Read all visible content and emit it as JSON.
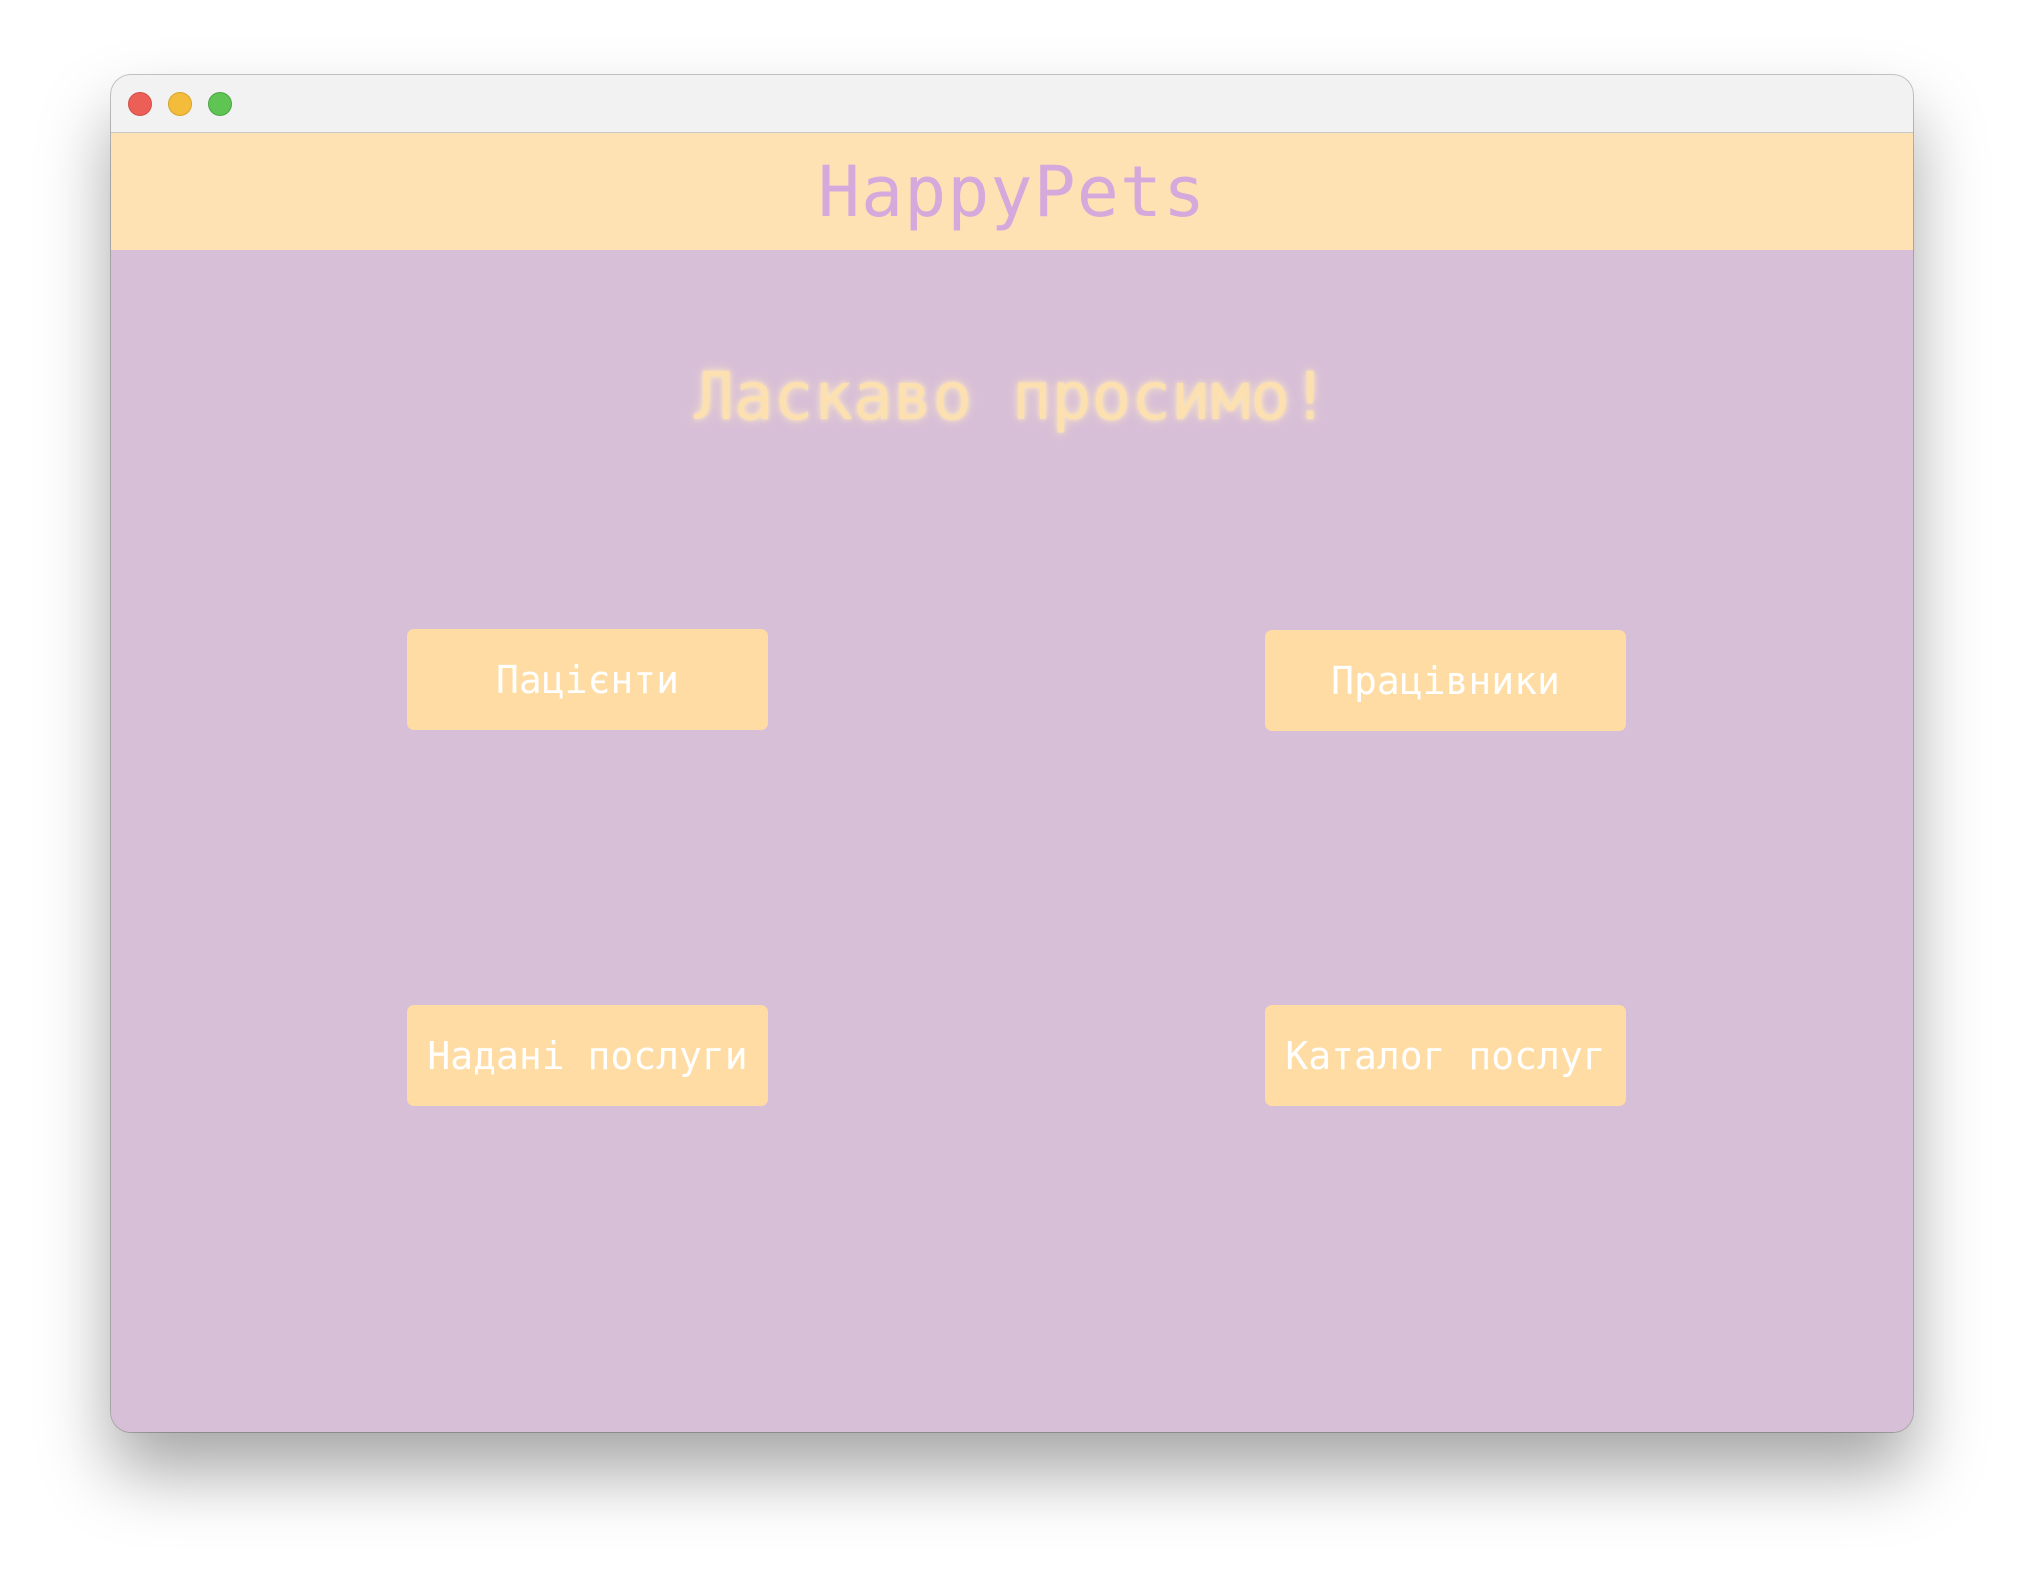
{
  "app": {
    "title": "HappyPets"
  },
  "main": {
    "welcome": "Ласкаво просимо!",
    "buttons": {
      "patients": "Пацієнти",
      "workers": "Працівники",
      "provided_services": "Надані послуги",
      "service_catalog": "Каталог послуг"
    }
  },
  "colors": {
    "header_background": "#ffe2b4",
    "content_background": "#d8bfd8",
    "title_text": "#d6a9dc",
    "button_background": "#fedca4",
    "button_text": "#ffffff",
    "welcome_text": "#fde0b0"
  },
  "icons": {
    "window_controls": [
      "close-icon",
      "minimize-icon",
      "zoom-icon"
    ]
  }
}
